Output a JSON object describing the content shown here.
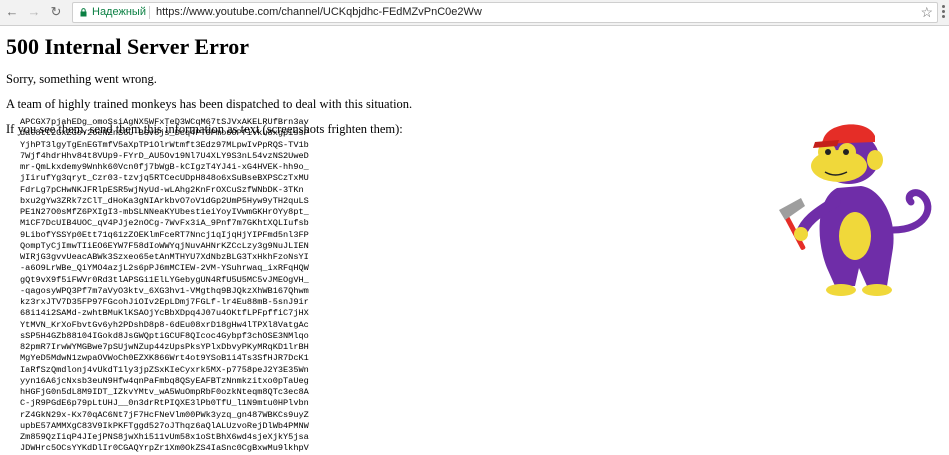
{
  "browser": {
    "secure_label": "Надежный",
    "url": "https://www.youtube.com/channel/UCKqbjdhc-FEdMZvPnC0e2Ww",
    "secure_color": "#0b8043"
  },
  "error": {
    "title": "500 Internal Server Error",
    "line1": "Sorry, something went wrong.",
    "line2": "A team of highly trained monkeys has been dispatched to deal with this situation.",
    "line3": "If you see them, send them this information as text (screenshots frighten them):",
    "info_lines": [
      "APCGX7pjahEDg_omoSsiAgNX5WFxTeD3WCqM67tSJVxAKELRUfBrn3av",
      "daC8tt2GxZGoY26eNZnS6U-BGv8js_Dcq4PT0Pmo6OPfivku8xgpissP",
      "YjhPT3lgyTgEnEGTmfV5aXpTP1OlrWtmft3Edz97MLpwIvPpRQS-TV1b",
      "7Wjf4hdrHhv84t8VUp9-FYrD_AU5Ov19Nl7U4XLY9S3nL54vzNS2UweD",
      "mr-QmLkxdemy9Wnhk60Vcn0fj7bWgB-kCIgzT4YJ4i-xG4HVEK-hh9o_",
      "jIirufYg3qryt_Czr03-tzvjq5RTCecUDpH848o6xSuBseBXPSCzTxMU",
      "FdrLg7pCHwNKJFRlpESR5wjNyUd-wLAhg2KnFrOXCuSzfWNbDK-3TKn",
      "bxu2gYw3ZRk7zClT_dHoKa3gNIArkbvO7oV1dGp2UmP5Hyw9yTH2quLS",
      "PE1N27O0sMfZ6PXIgI3-mbSLNNeaKYUbestieiYoyIVwmGKHrOYy8pt_",
      "M1CF7DcUIB4UOC_qV4PJje2nOCg-7WvFx3iA_9Pnf7m7GKhtXQLIufsb",
      "9LibofYSSYp0Ett71q61zZOEKlmFceRT7Nncj1qIjqHjYIPFmd5nl3FP",
      "QompTyCjImwTIiEO6EYW7F58dIoWWYqjNuvAHNrKZCcLzy3g9NuJLIEN",
      "WIRjG3gvvUeacABWk3Szxeo65etAnMTHYU7XdNbzBLG3TxHkhFzoNsYI",
      "-a6O9LrWBe_QiYMO4azjL2s6pPJ6mMCIEW-2VM-YSuhrwaq_ixRFqHQW",
      "gQt9vX9f5iFWVr0Rd3tlAPSGi1ElLYGebygUN4RfU5U5MC5vJMEOgVH_",
      "-qagosyWPQ3Pf7m7aVyO3ktv_6XG3hv1-VMgthq9BJQkzXhWB167Qhwm",
      "kz3rxJTV7D35FP97FGcohJiOIv2EpLDmj7FGLf-lr4Eu88mB-5snJ9ir",
      "68i14i2SAMd-zwhtBMuKlKSAOjYcBbXDpq4J07u4OKtfLPFpffiC7jHX",
      "YtMVN_KrXoFbvtGv6yh2PDshD8p8-6dEu08xrD18gHw4lTPXl8VatgAc",
      "sSP5H4GZb88104IGokd8JsGWQptiGCUF8QIcoc4Gybpf3chOSE3NMlqo",
      "82pmR7IrwWYMGBwe7pSUjwNZup44zUpsPksYPlxDbvyPKyMRqKD1lrBH",
      "MgYeD5MdwN1zwpaOVWoCh0EZXK866Wrt4ot9YSoB1i4Ts3SfHJR7DcK1",
      "IaRfSzQmdlonj4vUkdT1ly3jpZSxKIeCyxrk5MX-p7758peJ2Y3E35Wn",
      "yyn16A6jcNxsb3euN9Hfw4qnPaFmbq8QSyEAFBTzNnmkzitxo0pTaUeg",
      "hHGFjG0n5dL8M9IDT_IZkvYMtv_wA5WuOmpRbF0ozkNteqm8QTc3ec8A",
      "C-jR9PGdE6p79pLtUHJ__0n3drRtPIQXE3lPb0TfU_l1N9mtu0HPlvbn",
      "rZ4GkN29x-Kx70qAC6Nt7jF7HcFNeVlm00PWk3yzq_gn487WBKCs9uyZ",
      "upbE57AMMXgC83V9IkPKFTggd527oJThqz6aQlALUzvoRejDlWb4PMNW",
      "Zm859QzIiqP4JIejPNS8jwXhi511vUm58x1oStBhX6wd4sjeXjkY5jsa",
      "JDWHrc5OCsYYKdDlIr0CGAQYrpZr1Xm0OkZS4IaSnc0CgBxwMu9lkhpV"
    ]
  },
  "illustration": {
    "name": "monkey-with-hammer",
    "body_color": "#6f2da8",
    "cap_color": "#e52d27",
    "face_color": "#f0d83a",
    "hammer_color": "#9e9e9e"
  }
}
